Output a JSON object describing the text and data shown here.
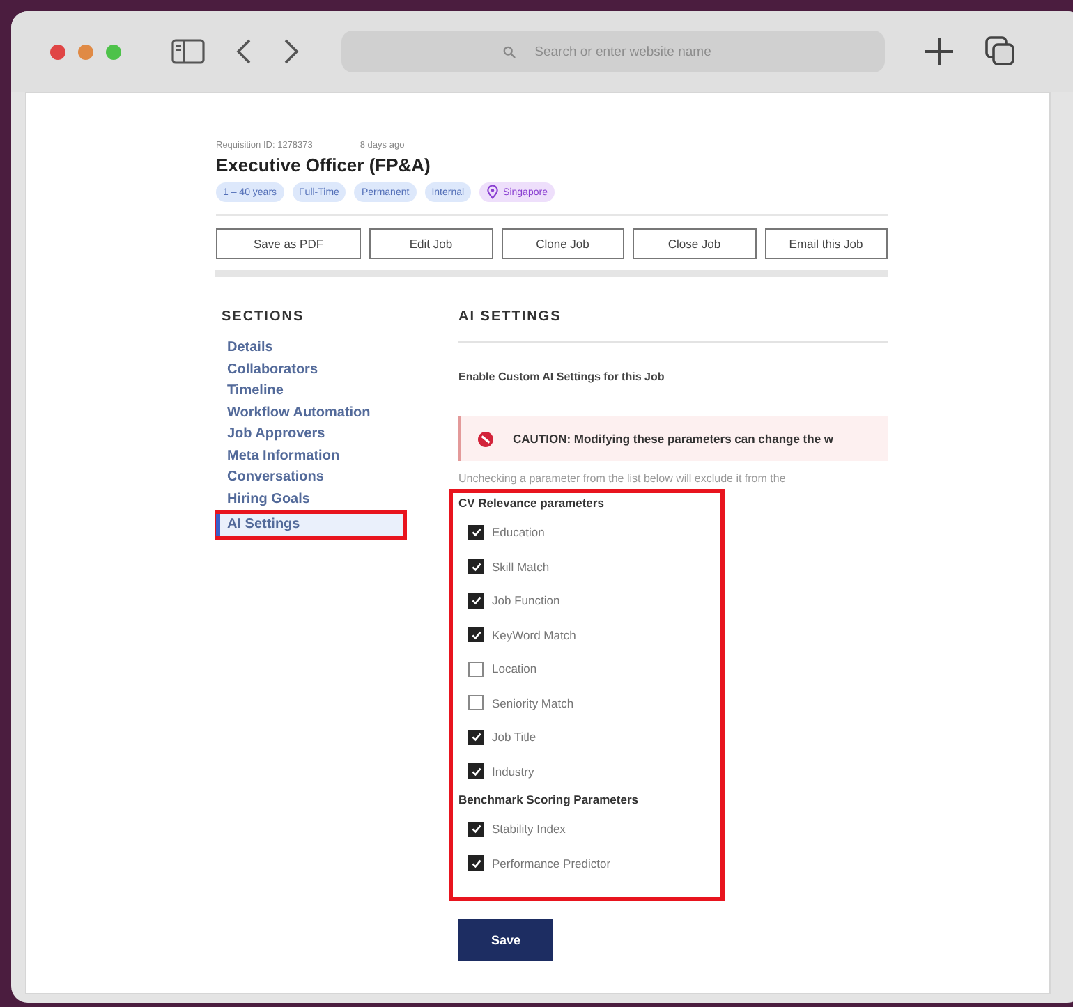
{
  "browser": {
    "address_placeholder": "Search or enter website name"
  },
  "job": {
    "requisition": "Requisition ID: 1278373",
    "age": "8 days ago",
    "title": "Executive Officer (FP&A)",
    "tags": [
      {
        "label": "1 – 40 years",
        "kind": "tag"
      },
      {
        "label": "Full-Time",
        "kind": "tag"
      },
      {
        "label": "Permanent",
        "kind": "tag"
      },
      {
        "label": "Internal",
        "kind": "tag"
      },
      {
        "label": "Singapore",
        "kind": "location"
      }
    ],
    "actions": [
      "Save as PDF",
      "Edit Job",
      "Clone Job",
      "Close Job",
      "Email this Job"
    ]
  },
  "sections": {
    "heading": "SECTIONS",
    "items": [
      {
        "label": "Details",
        "selected": false,
        "highlighted": false
      },
      {
        "label": "Collaborators",
        "selected": false,
        "highlighted": false
      },
      {
        "label": "Timeline",
        "selected": false,
        "highlighted": false
      },
      {
        "label": "Workflow Automation",
        "selected": false,
        "highlighted": false
      },
      {
        "label": "Job Approvers",
        "selected": false,
        "highlighted": false
      },
      {
        "label": "Meta Information",
        "selected": false,
        "highlighted": false
      },
      {
        "label": "Conversations",
        "selected": false,
        "highlighted": false
      },
      {
        "label": "Hiring Goals",
        "selected": false,
        "highlighted": false
      },
      {
        "label": "AI Settings",
        "selected": true,
        "highlighted": true
      }
    ]
  },
  "ai_settings": {
    "heading": "AI SETTINGS",
    "enable_label": "Enable Custom AI Settings for this Job",
    "caution": "CAUTION: Modifying these parameters can change the w",
    "note": "Unchecking a parameter from the list below will exclude it from the",
    "params_highlighted": true,
    "groups": [
      {
        "title": "CV Relevance parameters",
        "params": [
          {
            "label": "Education",
            "checked": true
          },
          {
            "label": "Skill Match",
            "checked": true
          },
          {
            "label": "Job Function",
            "checked": true
          },
          {
            "label": "KeyWord Match",
            "checked": true
          },
          {
            "label": "Location",
            "checked": false
          },
          {
            "label": "Seniority Match",
            "checked": false
          },
          {
            "label": "Job Title",
            "checked": true
          },
          {
            "label": "Industry",
            "checked": true
          }
        ]
      },
      {
        "title": "Benchmark Scoring Parameters",
        "params": [
          {
            "label": "Stability Index",
            "checked": true
          },
          {
            "label": "Performance Predictor",
            "checked": true
          }
        ]
      }
    ],
    "save": "Save"
  }
}
